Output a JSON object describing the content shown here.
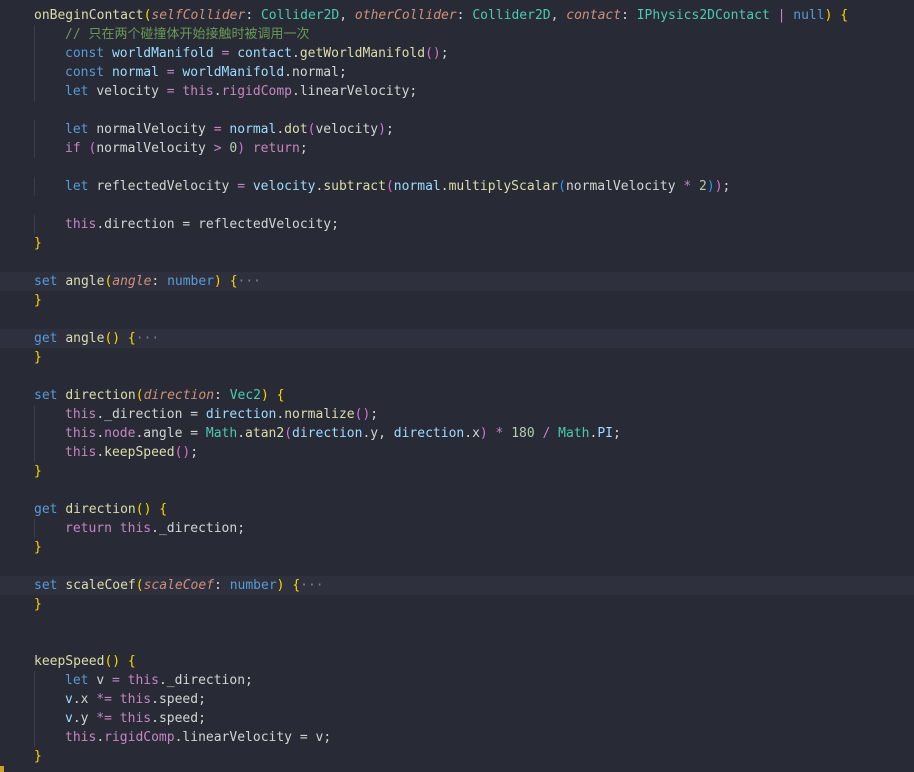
{
  "editor": {
    "lines": [
      {
        "folded": false,
        "tokens": [
          {
            "t": "onBeginContact",
            "c": "t-fn"
          },
          {
            "t": "(",
            "c": "t-b1"
          },
          {
            "t": "selfCollider",
            "c": "t-param"
          },
          {
            "t": ": ",
            "c": "t-plain"
          },
          {
            "t": "Collider2D",
            "c": "t-type"
          },
          {
            "t": ", ",
            "c": "t-plain"
          },
          {
            "t": "otherCollider",
            "c": "t-param"
          },
          {
            "t": ": ",
            "c": "t-plain"
          },
          {
            "t": "Collider2D",
            "c": "t-type"
          },
          {
            "t": ", ",
            "c": "t-plain"
          },
          {
            "t": "contact",
            "c": "t-param"
          },
          {
            "t": ": ",
            "c": "t-plain"
          },
          {
            "t": "IPhysics2DContact",
            "c": "t-type"
          },
          {
            "t": " | ",
            "c": "t-op"
          },
          {
            "t": "null",
            "c": "t-kw"
          },
          {
            "t": ")",
            "c": "t-b1"
          },
          {
            "t": " {",
            "c": "t-b1"
          }
        ]
      },
      {
        "folded": false,
        "indent": 1,
        "tokens": [
          {
            "t": "// 只在两个碰撞体开始接触时被调用一次",
            "c": "t-comment"
          }
        ]
      },
      {
        "folded": false,
        "indent": 1,
        "tokens": [
          {
            "t": "const ",
            "c": "t-kw"
          },
          {
            "t": "worldManifold",
            "c": "t-var"
          },
          {
            "t": " = ",
            "c": "t-op"
          },
          {
            "t": "contact",
            "c": "t-var"
          },
          {
            "t": ".",
            "c": "t-plain"
          },
          {
            "t": "getWorldManifold",
            "c": "t-fn"
          },
          {
            "t": "()",
            "c": "t-b2"
          },
          {
            "t": ";",
            "c": "t-plain"
          }
        ]
      },
      {
        "folded": false,
        "indent": 1,
        "tokens": [
          {
            "t": "const ",
            "c": "t-kw"
          },
          {
            "t": "normal",
            "c": "t-var"
          },
          {
            "t": " = ",
            "c": "t-op"
          },
          {
            "t": "worldManifold",
            "c": "t-var"
          },
          {
            "t": ".",
            "c": "t-plain"
          },
          {
            "t": "normal",
            "c": "t-prop"
          },
          {
            "t": ";",
            "c": "t-plain"
          }
        ]
      },
      {
        "folded": false,
        "indent": 1,
        "tokens": [
          {
            "t": "let ",
            "c": "t-kw"
          },
          {
            "t": "velocity",
            "c": "t-prop"
          },
          {
            "t": " = ",
            "c": "t-op"
          },
          {
            "t": "this",
            "c": "t-this"
          },
          {
            "t": ".",
            "c": "t-plain"
          },
          {
            "t": "rigidComp",
            "c": "t-this"
          },
          {
            "t": ".",
            "c": "t-plain"
          },
          {
            "t": "linearVelocity",
            "c": "t-prop"
          },
          {
            "t": ";",
            "c": "t-plain"
          }
        ]
      },
      {
        "folded": false,
        "tokens": []
      },
      {
        "folded": false,
        "indent": 1,
        "tokens": [
          {
            "t": "let ",
            "c": "t-kw"
          },
          {
            "t": "normalVelocity",
            "c": "t-prop"
          },
          {
            "t": " = ",
            "c": "t-op"
          },
          {
            "t": "normal",
            "c": "t-var"
          },
          {
            "t": ".",
            "c": "t-plain"
          },
          {
            "t": "dot",
            "c": "t-fn"
          },
          {
            "t": "(",
            "c": "t-b2"
          },
          {
            "t": "velocity",
            "c": "t-prop"
          },
          {
            "t": ")",
            "c": "t-b2"
          },
          {
            "t": ";",
            "c": "t-plain"
          }
        ]
      },
      {
        "folded": false,
        "indent": 1,
        "tokens": [
          {
            "t": "if ",
            "c": "t-ctrl"
          },
          {
            "t": "(",
            "c": "t-b2"
          },
          {
            "t": "normalVelocity",
            "c": "t-prop"
          },
          {
            "t": " > ",
            "c": "t-op"
          },
          {
            "t": "0",
            "c": "t-num"
          },
          {
            "t": ")",
            "c": "t-b2"
          },
          {
            "t": " return",
            "c": "t-ctrl"
          },
          {
            "t": ";",
            "c": "t-plain"
          }
        ]
      },
      {
        "folded": false,
        "tokens": []
      },
      {
        "folded": false,
        "indent": 1,
        "tokens": [
          {
            "t": "let ",
            "c": "t-kw"
          },
          {
            "t": "reflectedVelocity",
            "c": "t-prop"
          },
          {
            "t": " = ",
            "c": "t-op"
          },
          {
            "t": "velocity",
            "c": "t-var"
          },
          {
            "t": ".",
            "c": "t-plain"
          },
          {
            "t": "subtract",
            "c": "t-fn"
          },
          {
            "t": "(",
            "c": "t-b2"
          },
          {
            "t": "normal",
            "c": "t-var"
          },
          {
            "t": ".",
            "c": "t-plain"
          },
          {
            "t": "multiplyScalar",
            "c": "t-fn"
          },
          {
            "t": "(",
            "c": "t-b3"
          },
          {
            "t": "normalVelocity",
            "c": "t-prop"
          },
          {
            "t": " * ",
            "c": "t-op"
          },
          {
            "t": "2",
            "c": "t-num"
          },
          {
            "t": ")",
            "c": "t-b3"
          },
          {
            "t": ")",
            "c": "t-b2"
          },
          {
            "t": ";",
            "c": "t-plain"
          }
        ]
      },
      {
        "folded": false,
        "tokens": []
      },
      {
        "folded": false,
        "indent": 1,
        "tokens": [
          {
            "t": "this",
            "c": "t-this"
          },
          {
            "t": ".",
            "c": "t-plain"
          },
          {
            "t": "direction",
            "c": "t-prop"
          },
          {
            "t": " = ",
            "c": "t-plain"
          },
          {
            "t": "reflectedVelocity",
            "c": "t-prop"
          },
          {
            "t": ";",
            "c": "t-plain"
          }
        ]
      },
      {
        "folded": false,
        "tokens": [
          {
            "t": "}",
            "c": "t-b1"
          }
        ]
      },
      {
        "folded": false,
        "tokens": []
      },
      {
        "folded": true,
        "tokens": [
          {
            "t": "set ",
            "c": "t-kw"
          },
          {
            "t": "angle",
            "c": "t-fn"
          },
          {
            "t": "(",
            "c": "t-b1"
          },
          {
            "t": "angle",
            "c": "t-param"
          },
          {
            "t": ": ",
            "c": "t-plain"
          },
          {
            "t": "number",
            "c": "t-kw"
          },
          {
            "t": ")",
            "c": "t-b1"
          },
          {
            "t": " {",
            "c": "t-b1"
          },
          {
            "t": "···",
            "c": "t-fold"
          }
        ]
      },
      {
        "folded": false,
        "tokens": [
          {
            "t": "}",
            "c": "t-b1"
          }
        ]
      },
      {
        "folded": false,
        "tokens": []
      },
      {
        "folded": true,
        "tokens": [
          {
            "t": "get ",
            "c": "t-kw"
          },
          {
            "t": "angle",
            "c": "t-fn"
          },
          {
            "t": "()",
            "c": "t-b1"
          },
          {
            "t": " {",
            "c": "t-b1"
          },
          {
            "t": "···",
            "c": "t-fold"
          }
        ]
      },
      {
        "folded": false,
        "tokens": [
          {
            "t": "}",
            "c": "t-b1"
          }
        ]
      },
      {
        "folded": false,
        "tokens": []
      },
      {
        "folded": false,
        "tokens": [
          {
            "t": "set ",
            "c": "t-kw"
          },
          {
            "t": "direction",
            "c": "t-fn"
          },
          {
            "t": "(",
            "c": "t-b1"
          },
          {
            "t": "direction",
            "c": "t-param"
          },
          {
            "t": ": ",
            "c": "t-plain"
          },
          {
            "t": "Vec2",
            "c": "t-type"
          },
          {
            "t": ")",
            "c": "t-b1"
          },
          {
            "t": " {",
            "c": "t-b1"
          }
        ]
      },
      {
        "folded": false,
        "indent": 1,
        "tokens": [
          {
            "t": "this",
            "c": "t-this"
          },
          {
            "t": ".",
            "c": "t-plain"
          },
          {
            "t": "_direction",
            "c": "t-prop"
          },
          {
            "t": " = ",
            "c": "t-plain"
          },
          {
            "t": "direction",
            "c": "t-var"
          },
          {
            "t": ".",
            "c": "t-plain"
          },
          {
            "t": "normalize",
            "c": "t-fn"
          },
          {
            "t": "()",
            "c": "t-b2"
          },
          {
            "t": ";",
            "c": "t-plain"
          }
        ]
      },
      {
        "folded": false,
        "indent": 1,
        "tokens": [
          {
            "t": "this",
            "c": "t-this"
          },
          {
            "t": ".",
            "c": "t-plain"
          },
          {
            "t": "node",
            "c": "t-this"
          },
          {
            "t": ".",
            "c": "t-plain"
          },
          {
            "t": "angle",
            "c": "t-prop"
          },
          {
            "t": " = ",
            "c": "t-plain"
          },
          {
            "t": "Math",
            "c": "t-type"
          },
          {
            "t": ".",
            "c": "t-plain"
          },
          {
            "t": "atan2",
            "c": "t-fn"
          },
          {
            "t": "(",
            "c": "t-b2"
          },
          {
            "t": "direction",
            "c": "t-var"
          },
          {
            "t": ".",
            "c": "t-plain"
          },
          {
            "t": "y",
            "c": "t-prop"
          },
          {
            "t": ", ",
            "c": "t-plain"
          },
          {
            "t": "direction",
            "c": "t-var"
          },
          {
            "t": ".",
            "c": "t-plain"
          },
          {
            "t": "x",
            "c": "t-prop"
          },
          {
            "t": ")",
            "c": "t-b2"
          },
          {
            "t": " * ",
            "c": "t-op"
          },
          {
            "t": "180",
            "c": "t-num"
          },
          {
            "t": " / ",
            "c": "t-op"
          },
          {
            "t": "Math",
            "c": "t-type"
          },
          {
            "t": ".",
            "c": "t-plain"
          },
          {
            "t": "PI",
            "c": "t-var"
          },
          {
            "t": ";",
            "c": "t-plain"
          }
        ]
      },
      {
        "folded": false,
        "indent": 1,
        "tokens": [
          {
            "t": "this",
            "c": "t-this"
          },
          {
            "t": ".",
            "c": "t-plain"
          },
          {
            "t": "keepSpeed",
            "c": "t-fn"
          },
          {
            "t": "()",
            "c": "t-b2"
          },
          {
            "t": ";",
            "c": "t-plain"
          }
        ]
      },
      {
        "folded": false,
        "tokens": [
          {
            "t": "}",
            "c": "t-b1"
          }
        ]
      },
      {
        "folded": false,
        "tokens": []
      },
      {
        "folded": false,
        "tokens": [
          {
            "t": "get ",
            "c": "t-kw"
          },
          {
            "t": "direction",
            "c": "t-fn"
          },
          {
            "t": "()",
            "c": "t-b1"
          },
          {
            "t": " {",
            "c": "t-b1"
          }
        ]
      },
      {
        "folded": false,
        "indent": 1,
        "tokens": [
          {
            "t": "return ",
            "c": "t-ctrl"
          },
          {
            "t": "this",
            "c": "t-this"
          },
          {
            "t": ".",
            "c": "t-plain"
          },
          {
            "t": "_direction",
            "c": "t-prop"
          },
          {
            "t": ";",
            "c": "t-plain"
          }
        ]
      },
      {
        "folded": false,
        "tokens": [
          {
            "t": "}",
            "c": "t-b1"
          }
        ]
      },
      {
        "folded": false,
        "tokens": []
      },
      {
        "folded": true,
        "tokens": [
          {
            "t": "set ",
            "c": "t-kw"
          },
          {
            "t": "scaleCoef",
            "c": "t-fn"
          },
          {
            "t": "(",
            "c": "t-b1"
          },
          {
            "t": "scaleCoef",
            "c": "t-param"
          },
          {
            "t": ": ",
            "c": "t-plain"
          },
          {
            "t": "number",
            "c": "t-kw"
          },
          {
            "t": ")",
            "c": "t-b1"
          },
          {
            "t": " {",
            "c": "t-b1"
          },
          {
            "t": "···",
            "c": "t-fold"
          }
        ]
      },
      {
        "folded": false,
        "tokens": [
          {
            "t": "}",
            "c": "t-b1"
          }
        ]
      },
      {
        "folded": false,
        "tokens": []
      },
      {
        "folded": false,
        "tokens": []
      },
      {
        "folded": false,
        "tokens": [
          {
            "t": "keepSpeed",
            "c": "t-fn"
          },
          {
            "t": "()",
            "c": "t-b1"
          },
          {
            "t": " {",
            "c": "t-b1"
          }
        ]
      },
      {
        "folded": false,
        "indent": 1,
        "tokens": [
          {
            "t": "let ",
            "c": "t-kw"
          },
          {
            "t": "v",
            "c": "t-prop"
          },
          {
            "t": " = ",
            "c": "t-op"
          },
          {
            "t": "this",
            "c": "t-this"
          },
          {
            "t": ".",
            "c": "t-plain"
          },
          {
            "t": "_direction",
            "c": "t-prop"
          },
          {
            "t": ";",
            "c": "t-plain"
          }
        ]
      },
      {
        "folded": false,
        "indent": 1,
        "tokens": [
          {
            "t": "v",
            "c": "t-var"
          },
          {
            "t": ".",
            "c": "t-plain"
          },
          {
            "t": "x",
            "c": "t-prop"
          },
          {
            "t": " *= ",
            "c": "t-op"
          },
          {
            "t": "this",
            "c": "t-this"
          },
          {
            "t": ".",
            "c": "t-plain"
          },
          {
            "t": "speed",
            "c": "t-prop"
          },
          {
            "t": ";",
            "c": "t-plain"
          }
        ]
      },
      {
        "folded": false,
        "indent": 1,
        "tokens": [
          {
            "t": "v",
            "c": "t-var"
          },
          {
            "t": ".",
            "c": "t-plain"
          },
          {
            "t": "y",
            "c": "t-prop"
          },
          {
            "t": " *= ",
            "c": "t-op"
          },
          {
            "t": "this",
            "c": "t-this"
          },
          {
            "t": ".",
            "c": "t-plain"
          },
          {
            "t": "speed",
            "c": "t-prop"
          },
          {
            "t": ";",
            "c": "t-plain"
          }
        ]
      },
      {
        "folded": false,
        "indent": 1,
        "tokens": [
          {
            "t": "this",
            "c": "t-this"
          },
          {
            "t": ".",
            "c": "t-plain"
          },
          {
            "t": "rigidComp",
            "c": "t-this"
          },
          {
            "t": ".",
            "c": "t-plain"
          },
          {
            "t": "linearVelocity",
            "c": "t-prop"
          },
          {
            "t": " = ",
            "c": "t-plain"
          },
          {
            "t": "v",
            "c": "t-prop"
          },
          {
            "t": ";",
            "c": "t-plain"
          }
        ]
      },
      {
        "folded": false,
        "tokens": [
          {
            "t": "}",
            "c": "t-b1"
          }
        ]
      }
    ]
  }
}
